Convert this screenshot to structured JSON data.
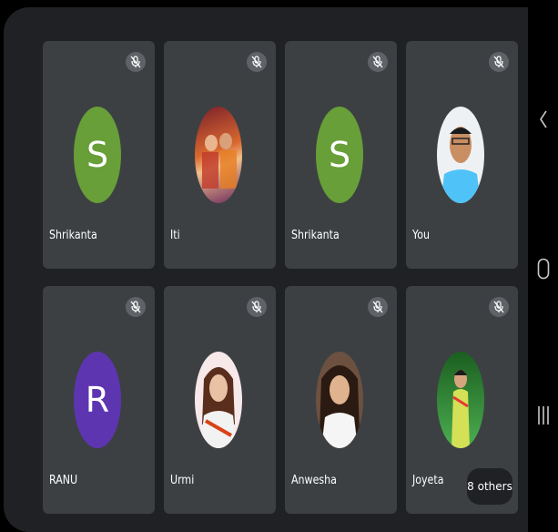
{
  "participants": [
    {
      "name": "Shrikanta",
      "initial": "S",
      "avatar_color": "#689f38",
      "avatar_type": "initial",
      "muted": true
    },
    {
      "name": "Iti",
      "initial": "",
      "avatar_color": "#b8532a",
      "avatar_type": "photo",
      "muted": true
    },
    {
      "name": "Shrikanta",
      "initial": "S",
      "avatar_color": "#689f38",
      "avatar_type": "initial",
      "muted": true
    },
    {
      "name": "You",
      "initial": "",
      "avatar_color": "#e9edf0",
      "avatar_type": "photo",
      "muted": true
    },
    {
      "name": "RANU",
      "initial": "R",
      "avatar_color": "#5e35b1",
      "avatar_type": "initial",
      "muted": true
    },
    {
      "name": "Urmi",
      "initial": "",
      "avatar_color": "#f3e5e7",
      "avatar_type": "photo",
      "muted": true
    },
    {
      "name": "Anwesha",
      "initial": "",
      "avatar_color": "#8b6a52",
      "avatar_type": "photo",
      "muted": true
    },
    {
      "name": "Joyeta",
      "initial": "",
      "avatar_color": "#2e7d32",
      "avatar_type": "photo",
      "muted": true
    }
  ],
  "others_label": "8 others",
  "colors": {
    "tile": "#3c4043",
    "background": "#202124",
    "mic_badge": "#5f6368"
  },
  "nav": {
    "back_icon": "back-chevron-icon",
    "home_icon": "home-icon",
    "recents_icon": "recents-icon"
  }
}
